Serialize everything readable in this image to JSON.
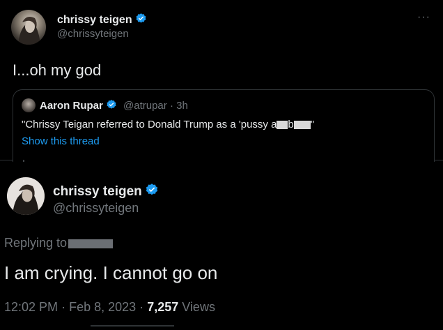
{
  "original_tweet": {
    "name": "chrissy teigen",
    "handle": "@chrissyteigen",
    "text": "I...oh my god",
    "more_label": "···",
    "quote": {
      "name": "Aaron Rupar",
      "handle": "@atrupar",
      "time": "3h",
      "text_before": "\"Chrissy Teigan referred to Donald Trump as a 'pussy a",
      "text_mid": "b",
      "text_after": "\"",
      "link": "Show this thread"
    }
  },
  "reply_tweet": {
    "name": "chrissy teigen",
    "handle": "@chrissyteigen",
    "replying_to": "Replying to",
    "text": "I am crying. I cannot go on",
    "time": "12:02 PM",
    "date": "Feb 8, 2023",
    "views_count": "7,257",
    "views_label": "Views"
  },
  "colors": {
    "background": "#000000",
    "primary_text": "#e7e9ea",
    "secondary_text": "#71767b",
    "link": "#1d9bf0",
    "verified": "#1d9bf0"
  },
  "icons": [
    "avatar",
    "verified-badge-icon",
    "more-options-icon"
  ]
}
